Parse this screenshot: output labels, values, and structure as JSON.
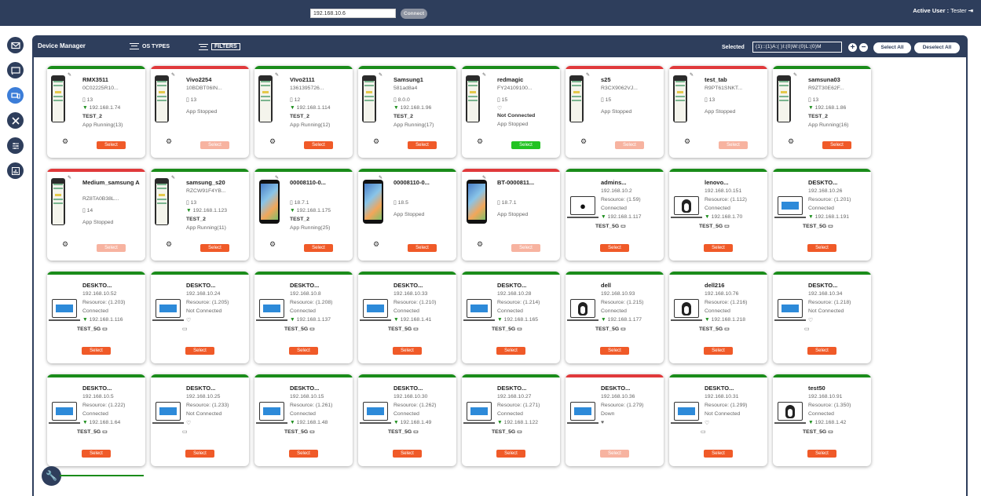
{
  "topbar": {
    "ip_value": "192.168.10.6",
    "connect_label": "Connect",
    "active_user_label": "Active User :",
    "active_user_name": "Tester"
  },
  "sidebar": {
    "icons": [
      "mail-icon",
      "cast-icon",
      "devices-icon",
      "tools-icon",
      "sliders-icon",
      "reports-icon"
    ]
  },
  "panel": {
    "title": "Device Manager",
    "os_types_label": "OS TYPES",
    "filters_label": "FILTERS",
    "selected_label": "Selected",
    "selected_value": "(1)::(1)A:( )I:(0)W:(0)L:(0)M",
    "select_all": "Select All",
    "deselect_all": "Deselect All"
  },
  "select_label": "Select",
  "devices": [
    {
      "kind": "android",
      "status": "green",
      "name": "RMX3511",
      "id": "0C02225R10...",
      "os": "13",
      "ip": "192.168.1.74",
      "group": "TEST_2",
      "state": "App Running(13)",
      "sel": "orange"
    },
    {
      "kind": "android",
      "status": "red",
      "name": "Vivo2254",
      "id": "10BDBT06IN...",
      "os": "13",
      "ip": "",
      "group": "",
      "state": "App Stopped",
      "sel": "faded"
    },
    {
      "kind": "android",
      "status": "green",
      "name": "VIvo2111",
      "id": "1361395726...",
      "os": "12",
      "ip": "192.168.1.114",
      "group": "TEST_2",
      "state": "App Running(12)",
      "sel": "orange"
    },
    {
      "kind": "android",
      "status": "green",
      "name": "Samsung1",
      "id": "581ad8a4",
      "os": "8.0.0",
      "ip": "192.168.1.96",
      "group": "TEST_2",
      "state": "App Running(17)",
      "sel": "orange"
    },
    {
      "kind": "android",
      "status": "green",
      "name": "redmagic",
      "id": "FY24109100...",
      "os": "15",
      "ip": "",
      "group": "",
      "notconn": "Not Connected",
      "state": "App Stopped",
      "sel": "greenbtn"
    },
    {
      "kind": "android",
      "status": "red",
      "name": "s25",
      "id": "R3CX9062VJ...",
      "os": "15",
      "ip": "",
      "group": "",
      "state": "App Stopped",
      "sel": "faded"
    },
    {
      "kind": "android",
      "status": "red",
      "name": "test_tab",
      "id": "R9PT61SNKT...",
      "os": "13",
      "ip": "",
      "group": "",
      "state": "App Stopped",
      "sel": "faded"
    },
    {
      "kind": "android",
      "status": "green",
      "name": "samsuna03",
      "id": "R9ZT30E62F...",
      "os": "13",
      "ip": "192.168.1.86",
      "group": "TEST_2",
      "state": "App Running(16)",
      "sel": "orange"
    },
    {
      "kind": "android",
      "status": "red",
      "name": "Medium_samsung A",
      "id": "RZ8TA0B38L...",
      "os": "14",
      "ip": "",
      "group": "",
      "state": "App Stopped",
      "sel": "faded"
    },
    {
      "kind": "android",
      "status": "green",
      "name": "samsung_s20",
      "id": "RZCW91F4YB...",
      "os": "13",
      "ip": "192.168.1.123",
      "group": "TEST_2",
      "state": "App Running(11)",
      "sel": "orange"
    },
    {
      "kind": "ios",
      "status": "green",
      "name": "00008110-0...",
      "id": "",
      "os": "18.7.1",
      "ip": "192.168.1.175",
      "group": "TEST_2",
      "state": "App Running(25)",
      "sel": "orange"
    },
    {
      "kind": "ios",
      "status": "green",
      "name": "00008110-0...",
      "id": "",
      "os": "18.5",
      "ip": "",
      "group": "",
      "state": "App Stopped",
      "sel": "orange"
    },
    {
      "kind": "ios",
      "status": "red",
      "name": "BT-0000811...",
      "id": "",
      "os": "18.7.1",
      "ip": "",
      "group": "",
      "state": "App Stopped",
      "sel": "faded"
    },
    {
      "kind": "mac",
      "status": "green",
      "name": "admins...",
      "ipaddr": "192.168.10.2",
      "res": "Resource: (1.59)",
      "conn": "Connected",
      "ip": "192.168.1.117",
      "group": "TEST_5G",
      "sel": "orange"
    },
    {
      "kind": "linux",
      "status": "green",
      "name": "lenovo...",
      "ipaddr": "192.168.10.151",
      "res": "Resource: (1.112)",
      "conn": "Connected",
      "ip": "192.168.1.70",
      "group": "TEST_5G",
      "sel": "orange"
    },
    {
      "kind": "win",
      "status": "green",
      "name": "DESKTO...",
      "ipaddr": "192.168.10.26",
      "res": "Resource: (1.201)",
      "conn": "Connected",
      "ip": "192.168.1.191",
      "group": "TEST_5G",
      "sel": "orange"
    },
    {
      "kind": "win",
      "status": "green",
      "name": "DESKTO...",
      "ipaddr": "192.168.10.52",
      "res": "Resource: (1.203)",
      "conn": "Connected",
      "ip": "192.168.1.116",
      "group": "TEST_5G",
      "sel": "orange"
    },
    {
      "kind": "win",
      "status": "green",
      "name": "DESKTO...",
      "ipaddr": "192.168.10.24",
      "res": "Resource: (1.205)",
      "conn": "Not Connected",
      "ip": "",
      "group": "",
      "sel": "orange"
    },
    {
      "kind": "win",
      "status": "green",
      "name": "DESKTO...",
      "ipaddr": "192.168.10.8",
      "res": "Resource: (1.208)",
      "conn": "Connected",
      "ip": "192.168.1.137",
      "group": "TEST_5G",
      "sel": "orange"
    },
    {
      "kind": "win",
      "status": "green",
      "name": "DESKTO...",
      "ipaddr": "192.168.10.33",
      "res": "Resource: (1.210)",
      "conn": "Connected",
      "ip": "192.168.1.41",
      "group": "TEST_5G",
      "sel": "orange"
    },
    {
      "kind": "win",
      "status": "green",
      "name": "DESKTO...",
      "ipaddr": "192.168.10.28",
      "res": "Resource: (1.214)",
      "conn": "Connected",
      "ip": "192.168.1.165",
      "group": "TEST_5G",
      "sel": "orange"
    },
    {
      "kind": "linux",
      "status": "green",
      "name": "dell",
      "ipaddr": "192.168.10.93",
      "res": "Resource: (1.215)",
      "conn": "Connected",
      "ip": "192.168.1.177",
      "group": "TEST_5G",
      "sel": "orange"
    },
    {
      "kind": "linux",
      "status": "green",
      "name": "dell216",
      "ipaddr": "192.168.10.76",
      "res": "Resource: (1.216)",
      "conn": "Connected",
      "ip": "192.168.1.218",
      "group": "TEST_5G",
      "sel": "orange"
    },
    {
      "kind": "win",
      "status": "green",
      "name": "DESKTO...",
      "ipaddr": "192.168.10.34",
      "res": "Resource: (1.218)",
      "conn": "Not Connected",
      "ip": "",
      "group": "",
      "sel": "orange"
    },
    {
      "kind": "win",
      "status": "green",
      "name": "DESKTO...",
      "ipaddr": "192.168.10.5",
      "res": "Resource: (1.222)",
      "conn": "Connected",
      "ip": "192.168.1.64",
      "group": "TEST_5G",
      "sel": "orange"
    },
    {
      "kind": "win",
      "status": "green",
      "name": "DESKTO...",
      "ipaddr": "192.168.10.25",
      "res": "Resource: (1.233)",
      "conn": "Not Connected",
      "ip": "",
      "group": "",
      "sel": "orange"
    },
    {
      "kind": "win",
      "status": "green",
      "name": "DESKTO...",
      "ipaddr": "192.168.10.15",
      "res": "Resource: (1.261)",
      "conn": "Connected",
      "ip": "192.168.1.48",
      "group": "TEST_5G",
      "sel": "orange"
    },
    {
      "kind": "win",
      "status": "green",
      "name": "DESKTO...",
      "ipaddr": "192.168.10.30",
      "res": "Resource: (1.262)",
      "conn": "Connected",
      "ip": "192.168.1.49",
      "group": "TEST_5G",
      "sel": "orange"
    },
    {
      "kind": "win",
      "status": "green",
      "name": "DESKTO...",
      "ipaddr": "192.168.10.27",
      "res": "Resource: (1.271)",
      "conn": "Connected",
      "ip": "192.168.1.122",
      "group": "TEST_5G",
      "sel": "orange"
    },
    {
      "kind": "win",
      "status": "red",
      "name": "DESKTO...",
      "ipaddr": "192.168.10.36",
      "res": "Resource: (1.279)",
      "conn": "Down",
      "ip": "",
      "group": "",
      "down": true,
      "sel": "faded"
    },
    {
      "kind": "win",
      "status": "green",
      "name": "DESKTO...",
      "ipaddr": "192.168.10.31",
      "res": "Resource: (1.299)",
      "conn": "Not Connected",
      "ip": "",
      "group": "",
      "sel": "orange"
    },
    {
      "kind": "linux",
      "status": "green",
      "name": "test50",
      "ipaddr": "192.168.10.91",
      "res": "Resource: (1.350)",
      "conn": "Connected",
      "ip": "192.168.1.42",
      "group": "TEST_5G",
      "sel": "orange"
    }
  ]
}
